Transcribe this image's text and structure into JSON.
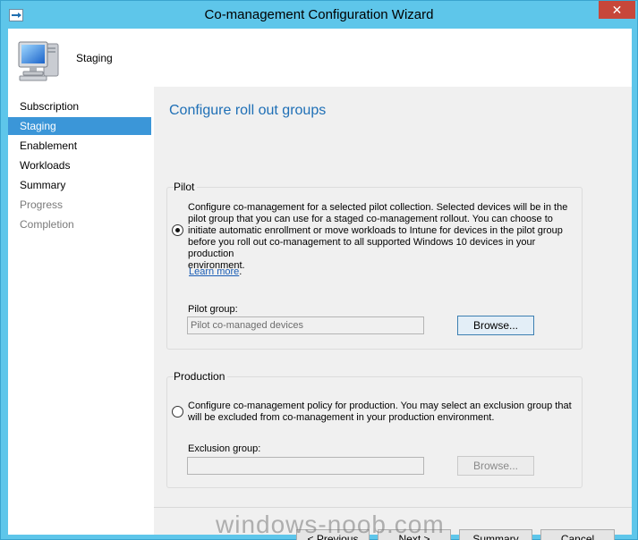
{
  "window": {
    "title": "Co-management Configuration Wizard",
    "close_glyph": "✕"
  },
  "header": {
    "title": "Staging",
    "icon": "computer-icon"
  },
  "nav": {
    "items": [
      {
        "label": "Subscription",
        "state": "normal"
      },
      {
        "label": "Staging",
        "state": "active"
      },
      {
        "label": "Enablement",
        "state": "normal"
      },
      {
        "label": "Workloads",
        "state": "normal"
      },
      {
        "label": "Summary",
        "state": "normal"
      },
      {
        "label": "Progress",
        "state": "disabled"
      },
      {
        "label": "Completion",
        "state": "disabled"
      }
    ]
  },
  "page": {
    "heading": "Configure roll out groups",
    "pilot": {
      "label": "Pilot",
      "description_lines": [
        "Configure co-management for a selected pilot collection. Selected devices will be in the",
        "pilot group that you can use for a staged co-management rollout. You can choose to",
        "initiate automatic enrollment or move workloads to Intune for devices in the pilot group",
        "before you roll out co-management to all supported Windows 10 devices in your production",
        "environment."
      ],
      "link_text": "Learn more",
      "link_suffix": ".",
      "field_label": "Pilot group:",
      "field_value": "Pilot co-managed devices",
      "browse_label": "Browse...",
      "selected": true
    },
    "production": {
      "label": "Production",
      "description_lines": [
        "Configure co-management policy for production. You may select an exclusion group that",
        "will be excluded from co-management in your production environment."
      ],
      "field_label": "Exclusion group:",
      "field_value": "",
      "browse_label": "Browse...",
      "selected": false
    }
  },
  "footer": {
    "previous_label": "< Previous",
    "next_label": "Next >",
    "summary_label": "Summary",
    "cancel_label": "Cancel"
  },
  "watermark": "windows-noob.com",
  "colors": {
    "title_bar": "#5ec6ea",
    "close_button": "#c7473a",
    "nav_active": "#3b96d8",
    "heading": "#1e6fb6",
    "link": "#1a5db5"
  }
}
